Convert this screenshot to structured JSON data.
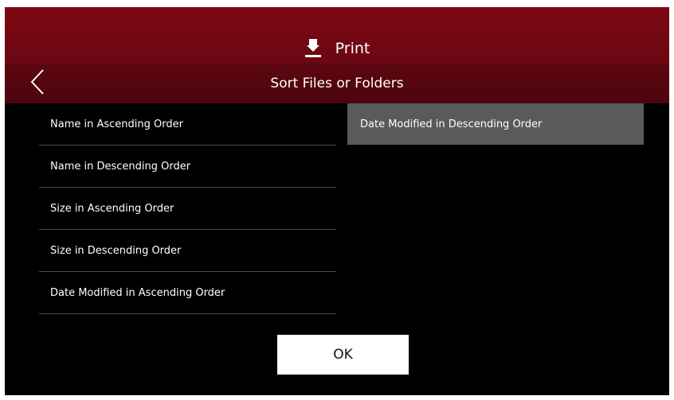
{
  "header": {
    "title": "Print",
    "icon": "print-icon"
  },
  "subheader": {
    "title": "Sort Files or Folders",
    "back_icon": "chevron-left-icon"
  },
  "options": [
    "Name in Ascending Order",
    "Name in Descending Order",
    "Size in Ascending Order",
    "Size in Descending Order",
    "Date Modified in Ascending Order",
    "Date Modified in Descending Order"
  ],
  "selected_option": "Date Modified in Descending Order",
  "ok_label": "OK",
  "colors": {
    "header_bg": "#7d0914",
    "subheader_bg": "#4c050d",
    "screen_bg": "#000000",
    "selected_bg": "#5a5a5a",
    "button_bg": "#ffffff"
  }
}
